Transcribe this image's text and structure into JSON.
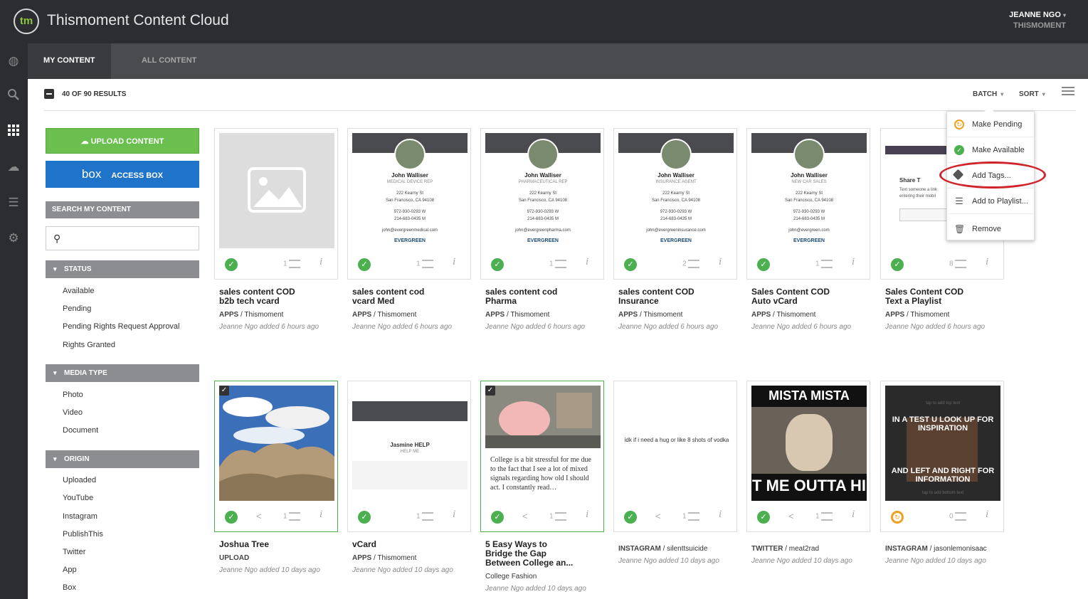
{
  "app": {
    "logo": "tm",
    "title": "Thismoment Content Cloud"
  },
  "user": {
    "name": "JEANNE NGO",
    "org": "THISMOMENT"
  },
  "rail": [
    "globe-icon",
    "search-icon",
    "grid-icon",
    "cloud-icon",
    "list-icon",
    "gear-icon"
  ],
  "tabs": [
    {
      "label": "MY CONTENT",
      "active": true
    },
    {
      "label": "ALL CONTENT",
      "active": false
    }
  ],
  "results": {
    "count": "40 OF 90 RESULTS",
    "batch": "BATCH",
    "sort": "SORT"
  },
  "sidebar": {
    "upload": "UPLOAD CONTENT",
    "box_logo": "box",
    "box": "ACCESS BOX",
    "search_header": "SEARCH MY CONTENT",
    "status": {
      "header": "STATUS",
      "items": [
        "Available",
        "Pending",
        "Pending Rights Request Approval",
        "Rights Granted"
      ]
    },
    "media": {
      "header": "MEDIA TYPE",
      "items": [
        "Photo",
        "Video",
        "Document"
      ]
    },
    "origin": {
      "header": "ORIGIN",
      "items": [
        "Uploaded",
        "YouTube",
        "Instagram",
        "PublishThis",
        "Twitter",
        "App",
        "Box"
      ]
    }
  },
  "batch_menu": {
    "items": [
      "Make Pending",
      "Make Available",
      "Add Tags...",
      "Add to Playlist...",
      "Remove"
    ]
  },
  "vcards": [
    {
      "name": "John Walliser",
      "role": "MEDICAL DEVICE REP",
      "addr1": "222 Kearny St",
      "addr2": "San Francisco, CA 94108",
      "ph1": "972-930-0293 W",
      "ph2": "214-683-0435 M",
      "email": "john@evergreenmedical.com",
      "brand": "EVERGREEN"
    },
    {
      "name": "John Walliser",
      "role": "PHARMACEUTICAL REP",
      "addr1": "222 Kearny St",
      "addr2": "San Francisco, CA 94108",
      "ph1": "972-930-0293 W",
      "ph2": "214-683-0435 M",
      "email": "john@evergreenpharma.com",
      "brand": "EVERGREEN"
    },
    {
      "name": "John Walliser",
      "role": "INSURANCE AGENT",
      "addr1": "222 Kearny St",
      "addr2": "San Francisco, CA 94108",
      "ph1": "972-930-0293 W",
      "ph2": "214-683-0435 M",
      "email": "john@evergreeninsurance.com",
      "brand": "EVERGREEN"
    },
    {
      "name": "John Walliser",
      "role": "NEW CAR SALES",
      "addr1": "222 Kearny St",
      "addr2": "San Francisco, CA 94108",
      "ph1": "972-930-0293 W",
      "ph2": "214-683-0435 M",
      "email": "john@evergreen.com",
      "brand": "EVERGREEN"
    }
  ],
  "thumbs": {
    "jasmine_name": "Jasmine HELP",
    "jasmine_role": "HELP ME",
    "share_title": "Share T",
    "share_text1": "Text someone a link",
    "share_text2": "entering their mobil",
    "college_text": "College is a bit stressful for me due to the fact that I see a lot of mixed signals regarding how old I should act. I constantly read…",
    "vodka_text": "idk if i need a hug or like 8 shots of vodka",
    "meme1_top": "MISTA MISTA",
    "meme1_bottom": "T ME OUTTA HI",
    "meme2_top": "IN A TEST U LOOK UP FOR INSPIRATION",
    "meme2_bottom": "AND LEFT AND RIGHT FOR INFORMATION",
    "meme2_hint_top": "tap to add top text",
    "meme2_hint_bottom": "tap to add bottom text"
  },
  "row1": [
    {
      "t1": "sales content COD",
      "t2": "b2b tech vcard",
      "cat": "APPS",
      "src": "Thismoment",
      "date": "Jeanne Ngo added 6 hours ago",
      "count": "1"
    },
    {
      "t1": "sales content cod",
      "t2": "vcard Med",
      "cat": "APPS",
      "src": "Thismoment",
      "date": "Jeanne Ngo added 6 hours ago",
      "count": "1"
    },
    {
      "t1": "sales content cod",
      "t2": "Pharma",
      "cat": "APPS",
      "src": "Thismoment",
      "date": "Jeanne Ngo added 6 hours ago",
      "count": "1"
    },
    {
      "t1": "sales content COD",
      "t2": "Insurance",
      "cat": "APPS",
      "src": "Thismoment",
      "date": "Jeanne Ngo added 6 hours ago",
      "count": "2"
    },
    {
      "t1": "Sales Content COD",
      "t2": "Auto vCard",
      "cat": "APPS",
      "src": "Thismoment",
      "date": "Jeanne Ngo added 6 hours ago",
      "count": "1"
    },
    {
      "t1": "Sales Content COD",
      "t2": "Text a Playlist",
      "cat": "APPS",
      "src": "Thismoment",
      "date": "Jeanne Ngo added 6 hours ago",
      "count": "8"
    }
  ],
  "row2": [
    {
      "t1": "Joshua Tree",
      "cat": "UPLOAD",
      "date": "Jeanne Ngo added 10 days ago",
      "count": "1"
    },
    {
      "t1": "vCard",
      "cat": "APPS",
      "src": "Thismoment",
      "date": "Jeanne Ngo added 10 days ago",
      "count": "1"
    },
    {
      "t1": "5 Easy Ways to",
      "t2": "Bridge the Gap",
      "t3": "Between College an...",
      "src": "College Fashion",
      "date": "Jeanne Ngo added 10 days ago",
      "count": "1"
    },
    {
      "cat": "INSTAGRAM",
      "src": "silenttsuicide",
      "date": "Jeanne Ngo added 10 days ago",
      "count": "1"
    },
    {
      "cat": "TWITTER",
      "src": "meat2rad",
      "date": "Jeanne Ngo added 10 days ago",
      "count": "1"
    },
    {
      "cat": "INSTAGRAM",
      "src": "jasonlemonisaac",
      "date": "Jeanne Ngo added 10 days ago",
      "count": "0"
    }
  ]
}
